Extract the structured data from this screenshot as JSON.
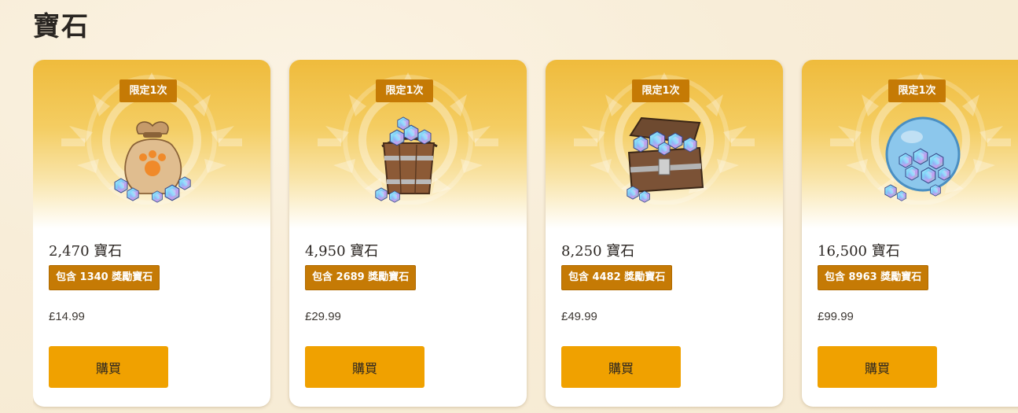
{
  "page": {
    "title": "寶石"
  },
  "products": [
    {
      "limit": "限定1次",
      "amount": "2,470 寶石",
      "bonus": "包含 1340 獎勵寶石",
      "price": "£14.99",
      "buy_label": "購買",
      "art": "paw-bag-icon"
    },
    {
      "limit": "限定1次",
      "amount": "4,950 寶石",
      "bonus": "包含 2689 獎勵寶石",
      "price": "£29.99",
      "buy_label": "購買",
      "art": "gem-bucket-icon"
    },
    {
      "limit": "限定1次",
      "amount": "8,250 寶石",
      "bonus": "包含 4482 獎勵寶石",
      "price": "£49.99",
      "buy_label": "購買",
      "art": "treasure-chest-icon"
    },
    {
      "limit": "限定1次",
      "amount": "16,500 寶石",
      "bonus": "包含 8963 獎勵寶石",
      "price": "£99.99",
      "buy_label": "購買",
      "art": "gem-bubble-icon"
    }
  ],
  "colors": {
    "accent": "#f0a100",
    "badge": "#c57a05",
    "hero": "#efbb3c"
  }
}
